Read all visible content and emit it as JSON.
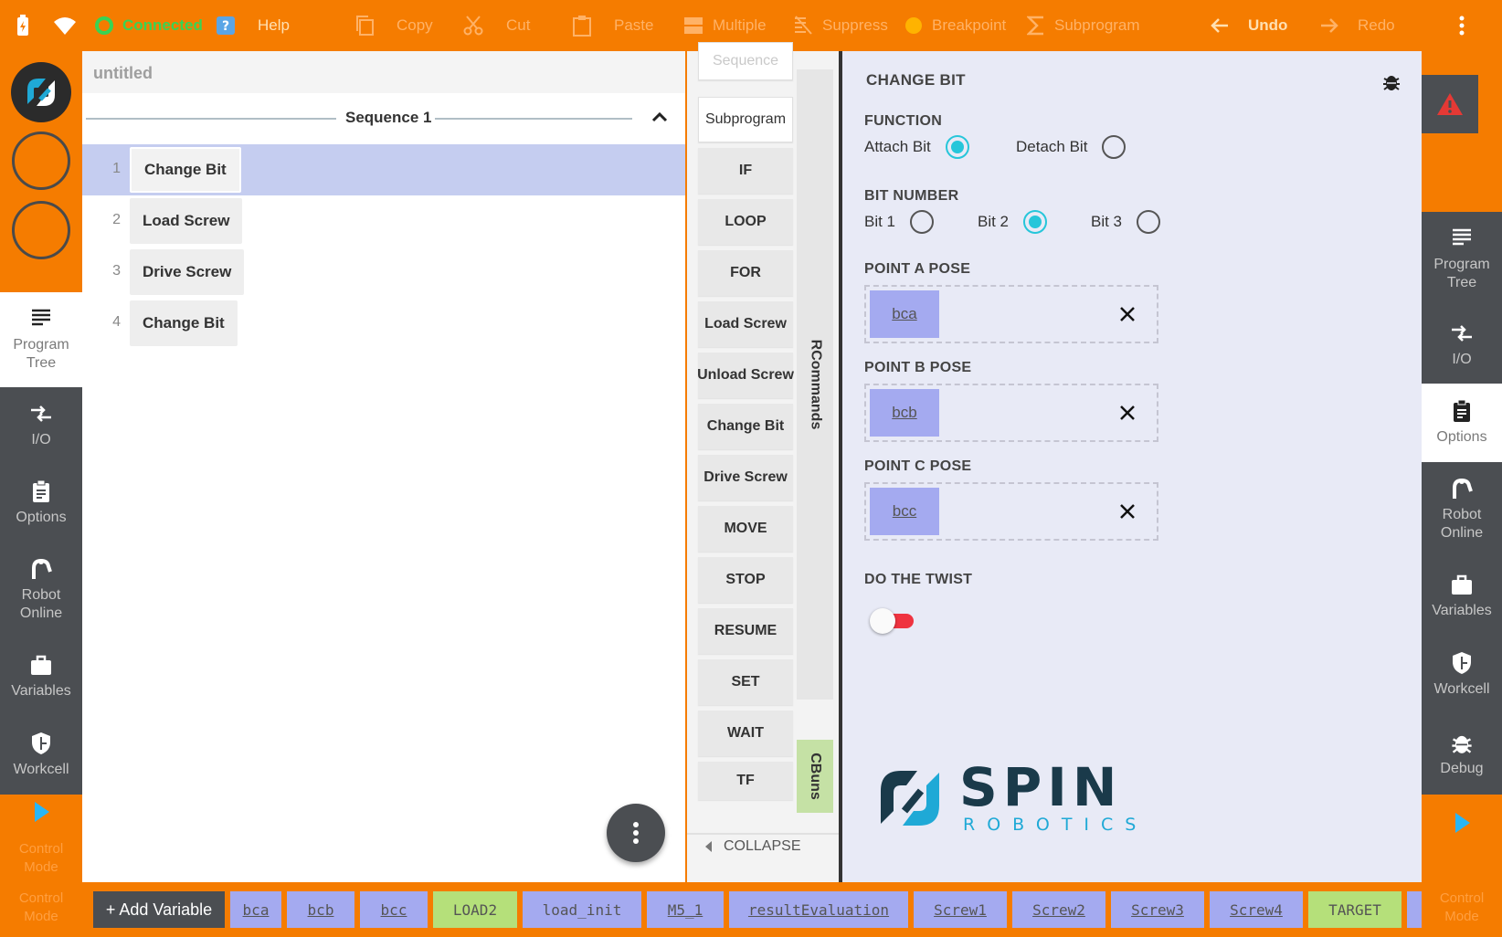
{
  "toolbar": {
    "connected": "Connected",
    "help": "Help",
    "copy": "Copy",
    "cut": "Cut",
    "paste": "Paste",
    "multiple": "Multiple",
    "suppress": "Suppress",
    "breakpoint": "Breakpoint",
    "subprogram": "Subprogram",
    "undo": "Undo",
    "redo": "Redo"
  },
  "left_nav": {
    "program_tree": "Program Tree",
    "io": "I/O",
    "options": "Options",
    "robot_online": "Robot Online",
    "variables": "Variables",
    "workcell": "Workcell",
    "control_mode": "Control Mode"
  },
  "program": {
    "title": "untitled",
    "sequence_label": "Sequence 1",
    "rows": [
      {
        "num": "1",
        "label": "Change Bit",
        "selected": true
      },
      {
        "num": "2",
        "label": "Load Screw",
        "selected": false
      },
      {
        "num": "3",
        "label": "Drive Screw",
        "selected": false
      },
      {
        "num": "4",
        "label": "Change Bit",
        "selected": false
      }
    ]
  },
  "palette": {
    "buttons": [
      "Sequence",
      "Subprogram",
      "IF",
      "LOOP",
      "FOR",
      "Load Screw",
      "Unload Screw",
      "Change Bit",
      "Drive Screw",
      "MOVE",
      "STOP",
      "RESUME",
      "SET",
      "WAIT",
      "TF"
    ],
    "rcommands": "RCommands",
    "cbuns": "CBuns",
    "collapse": "COLLAPSE"
  },
  "properties": {
    "title": "CHANGE BIT",
    "function_heading": "FUNCTION",
    "function_options": [
      {
        "label": "Attach Bit",
        "selected": true
      },
      {
        "label": "Detach Bit",
        "selected": false
      }
    ],
    "bit_heading": "BIT NUMBER",
    "bit_options": [
      {
        "label": "Bit 1",
        "selected": false
      },
      {
        "label": "Bit 2",
        "selected": true
      },
      {
        "label": "Bit 3",
        "selected": false
      }
    ],
    "pose_a_heading": "POINT A POSE",
    "pose_a_value": "bca",
    "pose_b_heading": "POINT B POSE",
    "pose_b_value": "bcb",
    "pose_c_heading": "POINT C POSE",
    "pose_c_value": "bcc",
    "twist_heading": "DO THE TWIST",
    "twist_enabled": false,
    "logo_text": "SPIN",
    "logo_subtext": "ROBOTICS"
  },
  "right_nav": {
    "program_tree": "Program Tree",
    "io": "I/O",
    "options": "Options",
    "robot_online": "Robot Online",
    "variables": "Variables",
    "workcell": "Workcell",
    "debug": "Debug",
    "control_mode": "Control Mode"
  },
  "variables": {
    "add_label": "+ Add Variable",
    "items": [
      "bca",
      "bcb",
      "bcc",
      "LOAD2",
      "load_init",
      "M5_1",
      "resultEvaluation",
      "Screw1",
      "Screw2",
      "Screw3",
      "Screw4",
      "TARGET"
    ]
  },
  "colors": {
    "accent": "#f57c00",
    "nav_dark": "#4b4e52",
    "selection": "#c5cdf0",
    "radio_on": "#26c6da",
    "var_blue": "#a4aaf0",
    "var_green": "#b5e07a",
    "toggle_off": "#ef3340",
    "connected": "#39d353"
  }
}
